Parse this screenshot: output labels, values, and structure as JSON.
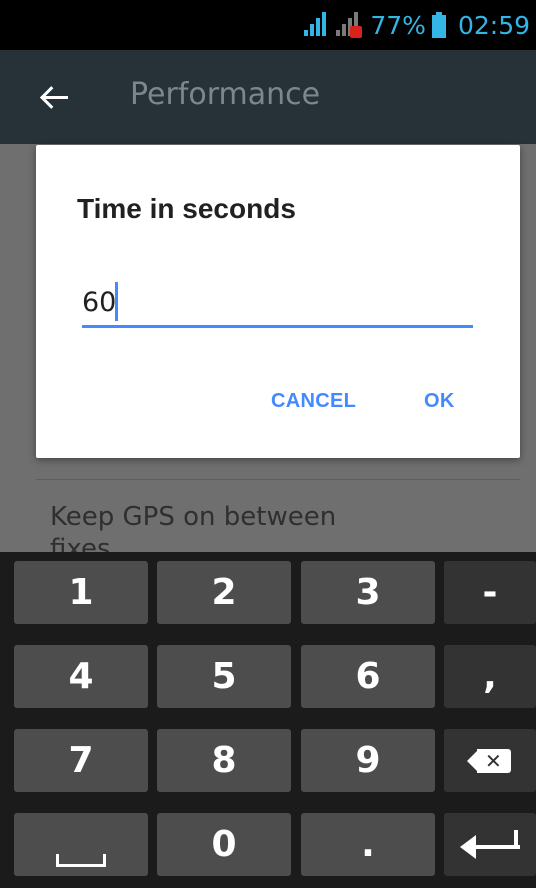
{
  "status_bar": {
    "battery_percent": "77%",
    "time": "02:59",
    "icons": [
      "cell-signal-icon",
      "cell-signal-edge-icon",
      "battery-icon"
    ]
  },
  "app_bar": {
    "title": "Performance",
    "back_icon": "arrow-back-icon"
  },
  "background_pref": {
    "title": "Keep GPS on between fixes"
  },
  "dialog": {
    "title": "Time in seconds",
    "input_value": "60",
    "cancel_label": "CANCEL",
    "ok_label": "OK",
    "accent_color": "#448aff"
  },
  "keyboard": {
    "row1": [
      "1",
      "2",
      "3",
      "-"
    ],
    "row2": [
      "4",
      "5",
      "6",
      ","
    ],
    "row3": [
      "7",
      "8",
      "9"
    ],
    "row4": [
      "0",
      "."
    ],
    "special_icons": [
      "backspace-icon",
      "space-icon",
      "enter-icon"
    ]
  }
}
